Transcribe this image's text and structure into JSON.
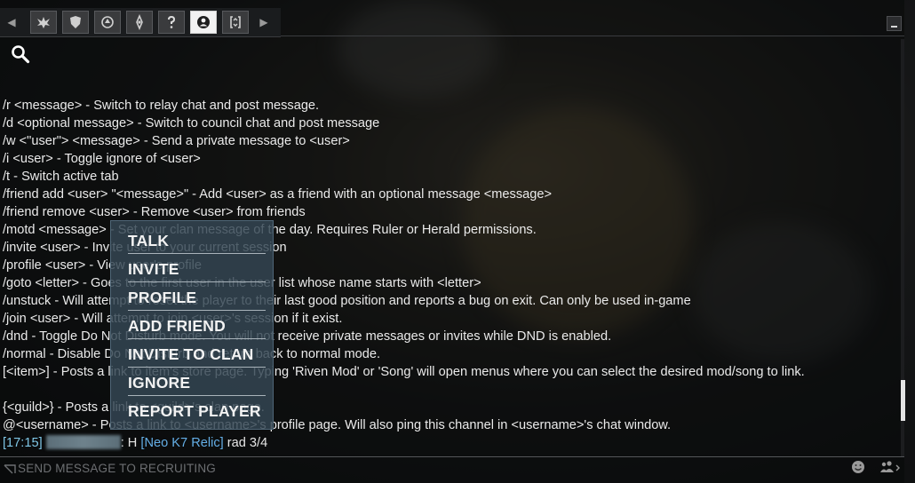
{
  "tabs": [
    {
      "name": "winged-emblem-icon"
    },
    {
      "name": "shield-icon"
    },
    {
      "name": "clan-emblem-icon"
    },
    {
      "name": "compass-icon"
    },
    {
      "name": "help-icon"
    },
    {
      "name": "recruiting-icon",
      "active": true
    },
    {
      "name": "trade-icon"
    }
  ],
  "chat_lines": [
    "/r <message> - Switch to relay chat and post message.",
    "/d <optional message> - Switch to council chat and post message",
    "/w <\"user\"> <message> - Send a private message to <user>",
    "/i <user> - Toggle ignore of <user>",
    "/t - Switch active tab",
    "/friend add <user> \"<message>\" - Add <user> as a friend with an optional message <message>",
    "/friend remove <user> - Remove <user> from friends",
    "/motd <message> - Set your clan message of the day. Requires Ruler or Herald permissions.",
    "/invite <user> - Invite user to your current session",
    "/profile <user> - View user's profile",
    "/goto <letter> - Goes to the first user in the user list whose name starts with <letter>",
    "/unstuck - Will attempt to reset the player to their last good position and reports a bug on exit. Can only be used in-game",
    "/join <user> - Will attempt to join <user>'s session if it exist.",
    "/dnd - Toggle Do Not Disturb mode. You will not receive private messages or invites while DND is enabled.",
    "/normal - Disable Do Not Disturb and return back to normal mode."
  ],
  "chat_wrap_line": "[<item>] - Posts a link to item's store page. Typing 'Riven Mod' or 'Song' will open menus where you can select the desired mod/song to link.",
  "chat_lines_2": [
    "{<guild>} - Posts a link to <guild>'s clan page.",
    "@<username> - Posts a link to <username>'s profile page. Will also ping this channel in <username>'s chat window."
  ],
  "last_message": {
    "timestamp": "[17:15]",
    "sep": ": H",
    "relic": "[Neo K7 Relic]",
    "rest": " rad 3/4"
  },
  "input_placeholder": "SEND MESSAGE TO RECRUITING",
  "context_menu": [
    "TALK",
    "INVITE",
    "PROFILE",
    "ADD FRIEND",
    "INVITE TO CLAN",
    "IGNORE",
    "REPORT PLAYER"
  ],
  "colors": {
    "timestamp": "#7fc6e6",
    "relic_link": "#64aee6",
    "context_menu_bg": "#344654"
  }
}
